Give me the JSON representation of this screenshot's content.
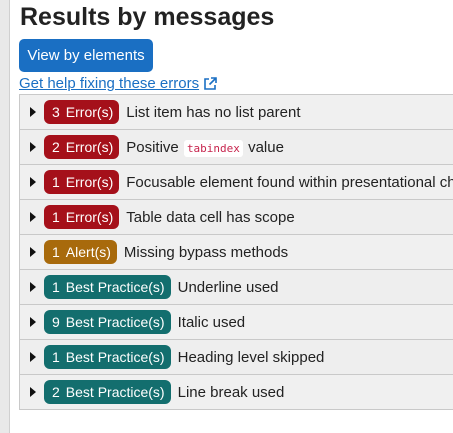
{
  "page": {
    "title": "Results by messages",
    "view_button": "View by elements",
    "help_link": "Get help fixing these errors"
  },
  "icons": {
    "external_link": "external-link-icon",
    "expand": "chevron-right-icon"
  },
  "colors": {
    "primary": "#1a6fc3",
    "error": "#a5101a",
    "alert": "#a86a0c",
    "best_practice": "#136e6e",
    "code": "#c7254e"
  },
  "results": [
    {
      "count": "3",
      "kind": "Error(s)",
      "text_before": "List item has no list parent",
      "code": "",
      "text_after": ""
    },
    {
      "count": "2",
      "kind": "Error(s)",
      "text_before": "Positive",
      "code": "tabindex",
      "text_after": "value"
    },
    {
      "count": "1",
      "kind": "Error(s)",
      "text_before": "Focusable element found within presentational child",
      "code": "",
      "text_after": ""
    },
    {
      "count": "1",
      "kind": "Error(s)",
      "text_before": "Table data cell has scope",
      "code": "",
      "text_after": ""
    },
    {
      "count": "1",
      "kind": "Alert(s)",
      "text_before": "Missing bypass methods",
      "code": "",
      "text_after": ""
    },
    {
      "count": "1",
      "kind": "Best Practice(s)",
      "text_before": "Underline used",
      "code": "",
      "text_after": ""
    },
    {
      "count": "9",
      "kind": "Best Practice(s)",
      "text_before": "Italic used",
      "code": "",
      "text_after": ""
    },
    {
      "count": "1",
      "kind": "Best Practice(s)",
      "text_before": "Heading level skipped",
      "code": "",
      "text_after": ""
    },
    {
      "count": "2",
      "kind": "Best Practice(s)",
      "text_before": "Line break used",
      "code": "",
      "text_after": ""
    }
  ]
}
